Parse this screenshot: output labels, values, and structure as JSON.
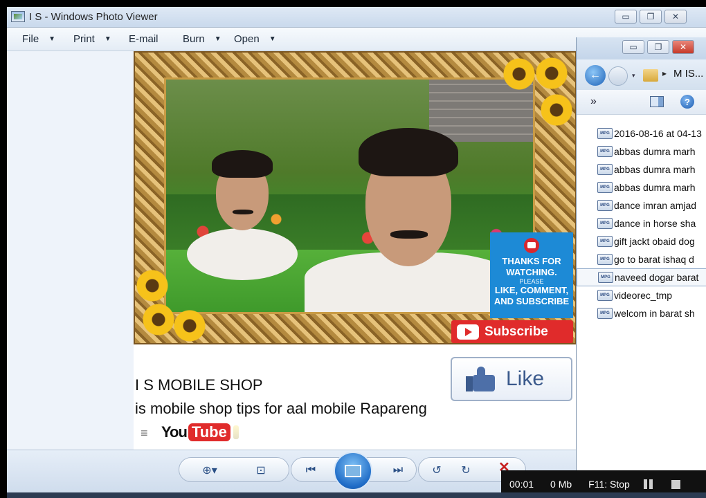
{
  "photo_viewer": {
    "title": "I S - Windows Photo Viewer",
    "window_buttons": {
      "minimize": "▭",
      "maximize": "❐",
      "close": "✕"
    },
    "menu": [
      {
        "label": "File",
        "has_dropdown": true
      },
      {
        "label": "Print",
        "has_dropdown": true
      },
      {
        "label": "E-mail",
        "has_dropdown": false
      },
      {
        "label": "Burn",
        "has_dropdown": true
      },
      {
        "label": "Open",
        "has_dropdown": true
      }
    ],
    "caret": "▼",
    "image": {
      "thanks_card": {
        "line1": "THANKS FOR",
        "line2": "WATCHING.",
        "line3": "PLEASE",
        "line4": "LIKE, COMMENT,",
        "line5": "AND SUBSCRIBE"
      },
      "subscribe_label": "Subscribe",
      "like_label": "Like",
      "caption_line1": "I S MOBILE SHOP",
      "caption_line2": "is mobile shop tips for aal mobile Rapareng",
      "youtube_you": "You",
      "youtube_tube": "Tube",
      "hamburger": "≡"
    },
    "toolbar": {
      "zoom": "⊕▾",
      "fit": "⊡",
      "previous": "⏮",
      "next": "⏭",
      "rotate_ccw": "↺",
      "rotate_cw": "↻",
      "delete": "✕"
    }
  },
  "recorder": {
    "time": "00:01",
    "size": "0 Mb",
    "stop_hint": "F11: Stop"
  },
  "explorer": {
    "back_arrow": "←",
    "dropdown_caret": "▾",
    "breadcrumb_sep": "▸",
    "address": "M IS...",
    "chevron": "»",
    "help": "?",
    "file_type_label": "MPG",
    "files": [
      {
        "name": "2016-08-16 at 04-13",
        "selected": false
      },
      {
        "name": "abbas dumra marh",
        "selected": false
      },
      {
        "name": "abbas dumra marh",
        "selected": false
      },
      {
        "name": "abbas dumra marh",
        "selected": false
      },
      {
        "name": "dance imran amjad",
        "selected": false
      },
      {
        "name": "dance in horse sha",
        "selected": false
      },
      {
        "name": "gift jackt obaid dog",
        "selected": false
      },
      {
        "name": "go to barat ishaq d",
        "selected": false
      },
      {
        "name": "naveed dogar barat",
        "selected": true
      },
      {
        "name": "videorec_tmp",
        "selected": false
      },
      {
        "name": "welcom in barat sh",
        "selected": false
      }
    ]
  }
}
